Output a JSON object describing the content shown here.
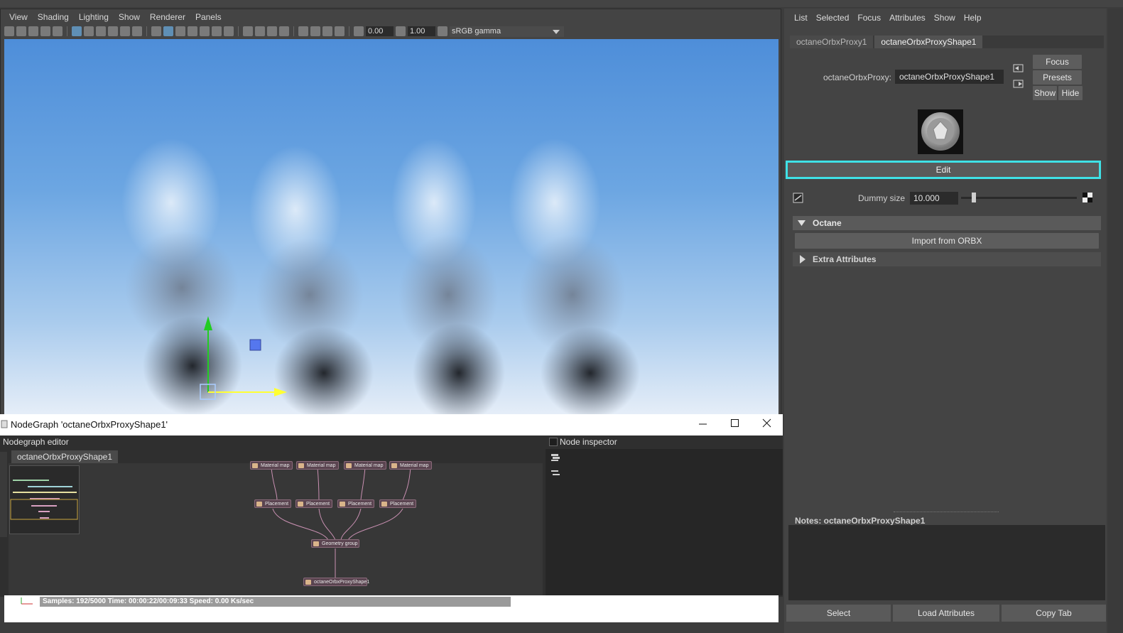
{
  "viewport": {
    "menu": [
      "View",
      "Shading",
      "Lighting",
      "Show",
      "Renderer",
      "Panels"
    ],
    "toolbar": {
      "field_a": "0.00",
      "field_b": "1.00",
      "color_space": "sRGB gamma"
    }
  },
  "attribute_editor": {
    "menu": [
      "List",
      "Selected",
      "Focus",
      "Attributes",
      "Show",
      "Help"
    ],
    "tabs": [
      "octaneOrbxProxy1",
      "octaneOrbxProxyShape1"
    ],
    "proxy_label": "octaneOrbxProxy:",
    "proxy_value": "octaneOrbxProxyShape1",
    "focus_label": "Focus",
    "presets_label": "Presets",
    "show_label": "Show",
    "hide_label": "Hide",
    "edit_label": "Edit",
    "dummy_size_label": "Dummy size",
    "dummy_size_value": "10.000",
    "dummy_slider_fraction": 0.1,
    "octane_section": "Octane",
    "import_label": "Import from ORBX",
    "extra_section": "Extra Attributes",
    "notes_label": "Notes:  octaneOrbxProxyShape1",
    "select_label": "Select",
    "load_label": "Load Attributes",
    "copy_label": "Copy Tab",
    "highlight_color": "#3fe1e6"
  },
  "nodegraph": {
    "window_title": "NodeGraph 'octaneOrbxProxyShape1'",
    "editor_label": "Nodegraph editor",
    "tab_label": "octaneOrbxProxyShape1",
    "inspector_label": "Node inspector",
    "nodes": {
      "material_maps": [
        "Material map",
        "Material map",
        "Material map",
        "Material map"
      ],
      "placements": [
        "Placement",
        "Placement",
        "Placement",
        "Placement"
      ],
      "geometry_group": "Geometry group",
      "output": "octaneOrbxProxyShape1"
    },
    "status": "Samples: 192/5000 Time: 00:00:22/00:09:33 Speed: 0.00 Ks/sec"
  }
}
